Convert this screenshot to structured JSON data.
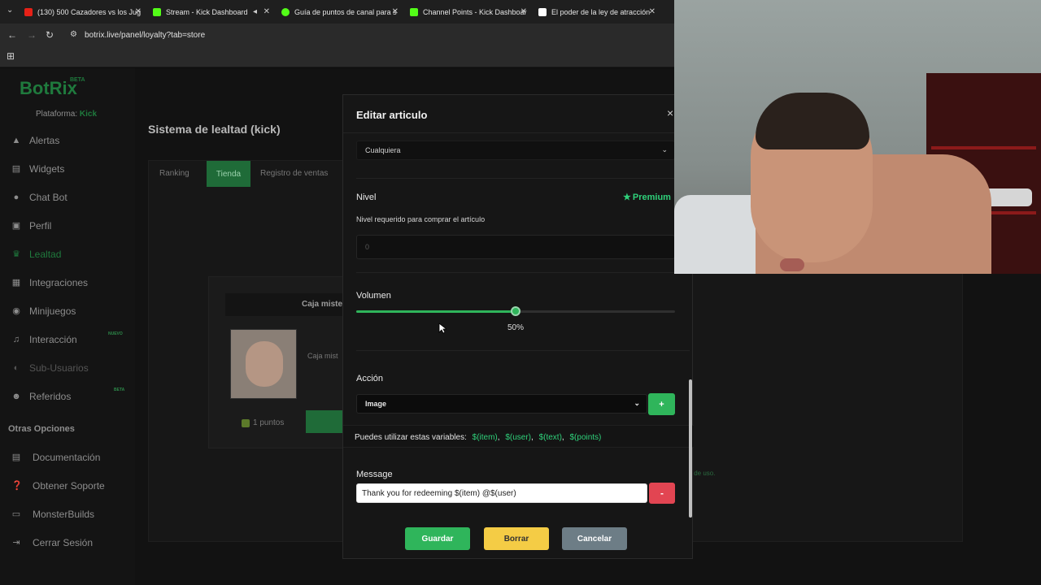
{
  "browser": {
    "tabs": [
      {
        "title": "(130) 500 Cazadores vs los Jug",
        "fav_color": "#e62117"
      },
      {
        "title": "Stream - Kick Dashboard",
        "fav_color": "#53fc18"
      },
      {
        "title": "Guía de puntos de canal para s",
        "fav_color": "#53fc18"
      },
      {
        "title": "Channel Points - Kick Dashboar",
        "fav_color": "#53fc18"
      },
      {
        "title": "El poder de la ley de atracción",
        "fav_color": "#ffffff"
      }
    ],
    "url": "botrix.live/panel/loyalty?tab=store"
  },
  "sidebar": {
    "logo": "BotRix",
    "logo_badge": "BETA",
    "platform_label": "Plataforma:",
    "platform_value": "Kick",
    "items": [
      {
        "label": "Alertas"
      },
      {
        "label": "Widgets"
      },
      {
        "label": "Chat Bot"
      },
      {
        "label": "Perfil"
      },
      {
        "label": "Lealtad"
      },
      {
        "label": "Integraciones"
      },
      {
        "label": "Minijuegos"
      },
      {
        "label": "Interacción",
        "badge": "NUEVO"
      },
      {
        "label": "Sub-Usuarios"
      },
      {
        "label": "Referidos",
        "badge": "BETA"
      }
    ],
    "section_title": "Otras Opciones",
    "other_items": [
      {
        "label": "Documentación"
      },
      {
        "label": "Obtener Soporte"
      },
      {
        "label": "MonsterBuilds"
      },
      {
        "label": "Cerrar Sesión"
      }
    ]
  },
  "main": {
    "title": "Sistema de lealtad (kick)",
    "tabs": [
      "Ranking",
      "Tienda",
      "Registro de ventas"
    ],
    "card_title": "Caja miste",
    "card_desc": "Caja mist",
    "card_points": "1 puntos",
    "footer_text": "s de uso."
  },
  "modal": {
    "title": "Editar articulo",
    "close": "×",
    "select_value": "Cualquiera",
    "nivel_label": "Nivel",
    "premium": "Premium",
    "nivel_help": "Nivel requerido para comprar el artículo",
    "nivel_value": "0",
    "volume_label": "Volumen",
    "volume_value": 0.5,
    "volume_text": "50%",
    "accion_label": "Acción",
    "accion_value": "Image",
    "add_symbol": "+",
    "variables_prefix": "Puedes utilizar estas variables:",
    "variables": [
      "$(item)",
      "$(user)",
      "$(text)",
      "$(points)"
    ],
    "message_label": "Message",
    "message_value": "Thank you for redeeming $(item) @$(user)",
    "remove_symbol": "-",
    "buttons": {
      "save": "Guardar",
      "delete": "Borrar",
      "cancel": "Cancelar"
    }
  },
  "colors": {
    "accent": "#2fb55b",
    "premium": "#2fd07a",
    "danger": "#e24552",
    "warning": "#f4cc45",
    "muted": "#6d7d86"
  }
}
